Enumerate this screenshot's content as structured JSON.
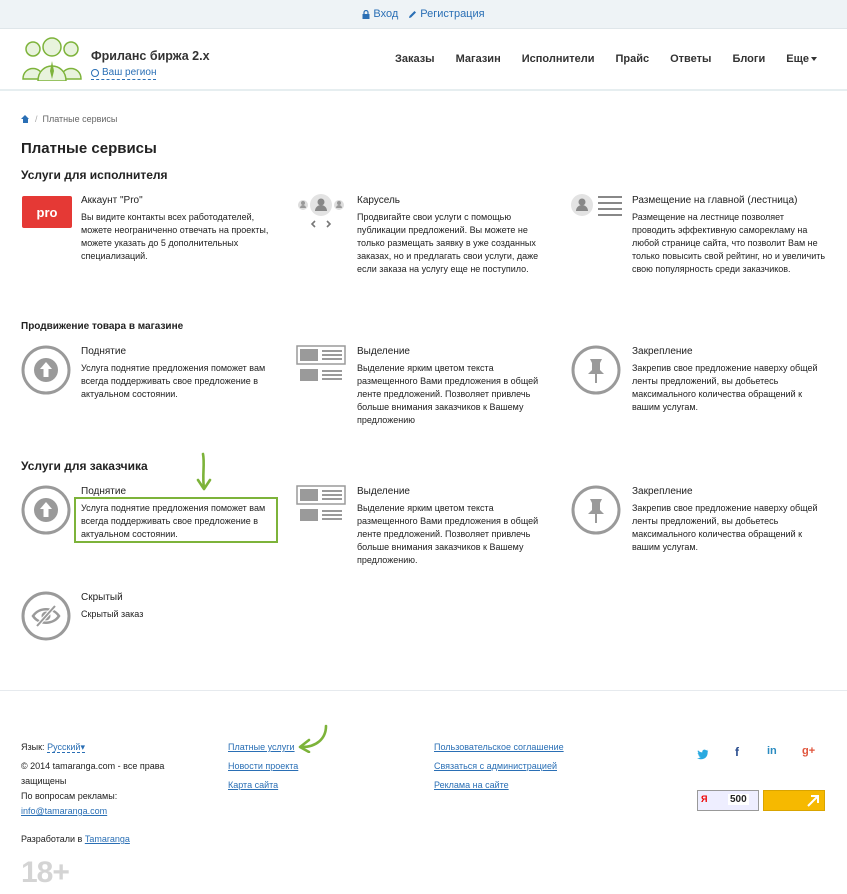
{
  "topbar": {
    "login": "Вход",
    "register": "Регистрация"
  },
  "header": {
    "title": "Фриланс биржа 2.x",
    "region": "Ваш регион",
    "nav": [
      "Заказы",
      "Магазин",
      "Исполнители",
      "Прайс",
      "Ответы",
      "Блоги",
      "Еще"
    ]
  },
  "breadcrumb": {
    "current": "Платные сервисы"
  },
  "page_title": "Платные сервисы",
  "sections": {
    "performer": {
      "title": "Услуги для исполнителя",
      "items": [
        {
          "title": "Аккаунт \"Pro\"",
          "badge": "pro",
          "desc": "Вы видите контакты всех работодателей, можете неограниченно отвечать на проекты, можете указать до 5 дополнительных специализаций."
        },
        {
          "title": "Карусель",
          "desc": "Продвигайте свои услуги с помощью публикации предложений. Вы можете не только размещать заявку в уже созданных заказах, но и предлагать свои услуги, даже если заказа на услугу еще не поступило."
        },
        {
          "title": "Размещение на главной (лестница)",
          "desc": "Размещение на лестнице позволяет проводить эффективную саморекламу на любой странице сайта, что позволит Вам не только повысить свой рейтинг, но и увеличить свою популярность среди заказчиков."
        }
      ]
    },
    "shop": {
      "title": "Продвижение товара в магазине",
      "items": [
        {
          "title": "Поднятие",
          "desc": "Услуга поднятие предложения поможет вам всегда поддерживать свое предложение в актуальном состоянии."
        },
        {
          "title": "Выделение",
          "desc": "Выделение ярким цветом текста размещенного Вами предложения в общей ленте предложений. Позволяет привлечь больше внимания заказчиков к Вашему предложению"
        },
        {
          "title": "Закрепление",
          "desc": "Закрепив свое предложение наверху общей ленты предложений, вы добьетесь максимального количества обращений к вашим услугам."
        }
      ]
    },
    "customer": {
      "title": "Услуги для заказчика",
      "items": [
        {
          "title": "Поднятие",
          "desc": "Услуга поднятие предложения поможет вам всегда поддерживать свое предложение в актуальном состоянии."
        },
        {
          "title": "Выделение",
          "desc": "Выделение ярким цветом текста размещенного Вами предложения в общей ленте предложений. Позволяет привлечь больше внимания заказчиков к Вашему предложению."
        },
        {
          "title": "Закрепление",
          "desc": "Закрепив свое предложение наверху общей ленты предложений, вы добьетесь максимального количества обращений к вашим услугам."
        },
        {
          "title": "Скрытый",
          "desc": "Скрытый заказ"
        }
      ]
    }
  },
  "footer": {
    "lang_label": "Язык:",
    "lang_value": "Русский",
    "copyright": "© 2014 tamaranga.com - все права защищены",
    "ads_label": "По вопросам рекламы:",
    "ads_email": "info@tamaranga.com",
    "dev_label": "Разработали в",
    "dev_link": "Tamaranga",
    "links_col1": [
      "Платные услуги",
      "Новости проекта",
      "Карта сайта"
    ],
    "links_col2": [
      "Пользовательское соглашение",
      "Связаться с администрацией",
      "Реклама на сайте"
    ],
    "social": [
      "twitter-icon",
      "facebook-icon",
      "linkedin-icon",
      "googleplus-icon"
    ],
    "age": "18+",
    "counter_value": "500"
  },
  "colors": {
    "accent": "#2a6fb5",
    "pro": "#e53935",
    "highlight": "#7db33a",
    "icon_gray": "#9a9a9a"
  }
}
